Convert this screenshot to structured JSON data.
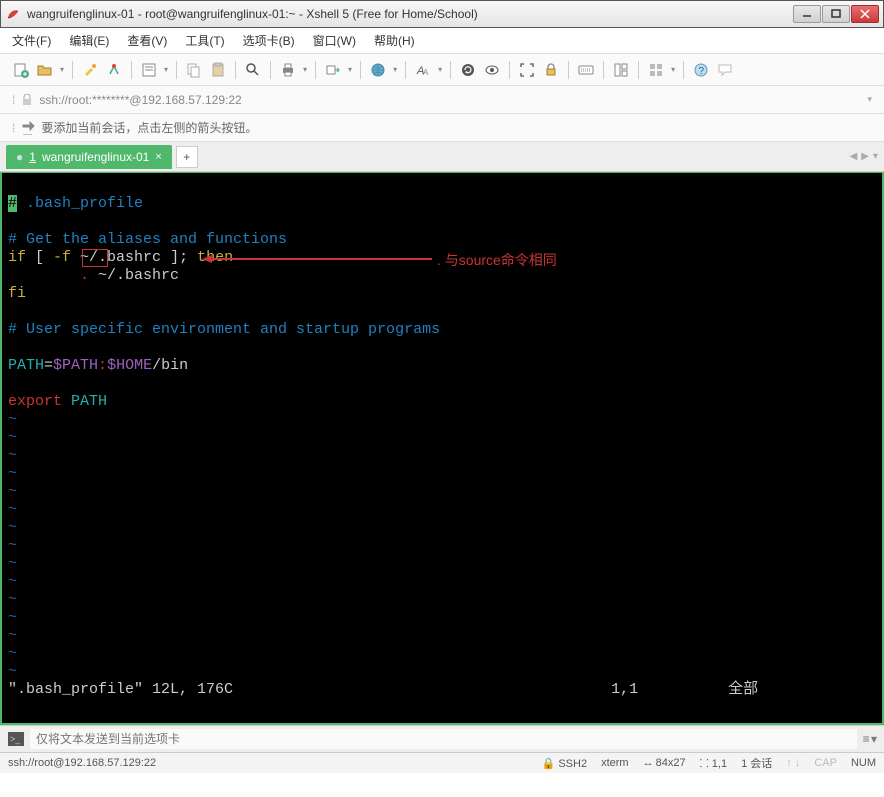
{
  "window": {
    "title": "wangruifenglinux-01 - root@wangruifenglinux-01:~ - Xshell 5 (Free for Home/School)"
  },
  "menu": {
    "file": "文件(F)",
    "edit": "编辑(E)",
    "view": "查看(V)",
    "tools": "工具(T)",
    "tab": "选项卡(B)",
    "window": "窗口(W)",
    "help": "帮助(H)"
  },
  "address": {
    "url": "ssh://root:********@192.168.57.129:22"
  },
  "hint": {
    "text": "要添加当前会话，点击左侧的箭头按钮。"
  },
  "tab": {
    "index": "1",
    "label": "wangruifenglinux-01"
  },
  "terminal": {
    "l1a": "#",
    "l1b": " .bash_profile",
    "l2": "# Get the aliases and functions",
    "l3a": "if",
    "l3b": " [ ",
    "l3c": "-f",
    "l3d": " ~/.bashrc ]; ",
    "l3e": "then",
    "l4a": "        .",
    "l4b": " ~/.bashrc",
    "l5": "fi",
    "l6": "# User specific environment and startup programs",
    "l7a": "PATH",
    "l7b": "=",
    "l7c": "$PATH",
    "l7d": ":",
    "l7e": "$HOME",
    "l7f": "/bin",
    "l8a": "export",
    "l8b": " ",
    "l8c": "PATH",
    "tilde": "~",
    "status": "\".bash_profile\" 12L, 176C",
    "pos": "1,1",
    "all": "全部"
  },
  "annotation": ". 与source命令相同",
  "inputbar": {
    "placeholder": "仅将文本发送到当前选项卡"
  },
  "statusbar": {
    "conn": "ssh://root@192.168.57.129:22",
    "ssh": "SSH2",
    "term": "xterm",
    "size": "84x27",
    "pos": "1,1",
    "sess": "1 会话",
    "cap": "CAP",
    "num": "NUM"
  }
}
